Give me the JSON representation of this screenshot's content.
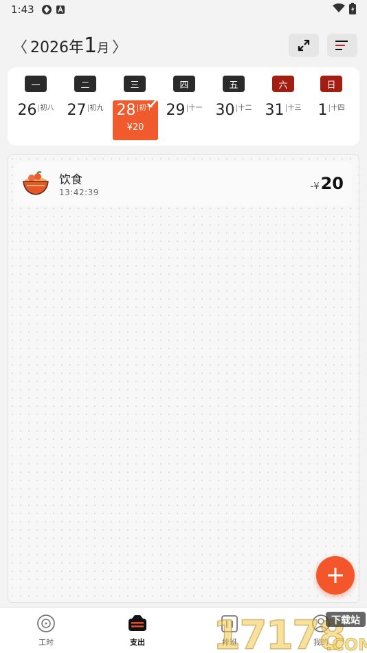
{
  "status_bar": {
    "time": "1:43",
    "icons": [
      "app-notification-icon",
      "a-badge-icon"
    ],
    "right_icons": [
      "wifi-icon",
      "battery-icon"
    ]
  },
  "header": {
    "prev": "〈",
    "year": "2026年",
    "month_num": "1",
    "month_suffix": "月",
    "next": "〉",
    "expand_icon": "expand-icon",
    "menu_icon": "menu-icon"
  },
  "week": {
    "days": [
      {
        "weekday": "一",
        "date": "26",
        "lunar": "初八",
        "weekend": false
      },
      {
        "weekday": "二",
        "date": "27",
        "lunar": "初九",
        "weekend": false
      },
      {
        "weekday": "三",
        "date": "28",
        "lunar": "初十",
        "weekend": false,
        "selected": true,
        "amount": "¥20"
      },
      {
        "weekday": "四",
        "date": "29",
        "lunar": "十一",
        "weekend": false
      },
      {
        "weekday": "五",
        "date": "30",
        "lunar": "十二",
        "weekend": false
      },
      {
        "weekday": "六",
        "date": "31",
        "lunar": "十三",
        "weekend": true
      },
      {
        "weekday": "日",
        "date": "1",
        "lunar": "十四",
        "weekend": true
      }
    ]
  },
  "records": [
    {
      "category": "饮食",
      "time": "13:42:39",
      "sign": "-¥",
      "amount": "20",
      "icon": "food-bowl-icon"
    }
  ],
  "bottom_nav": {
    "items": [
      {
        "label": "工时",
        "icon": "clock-icon",
        "active": false
      },
      {
        "label": "支出",
        "icon": "wallet-icon",
        "active": true
      },
      {
        "label": "排班",
        "icon": "schedule-icon",
        "active": false
      },
      {
        "label": "我的",
        "icon": "profile-icon",
        "active": false
      }
    ]
  },
  "watermark": {
    "text": "17178",
    "tag": "下载站",
    "suffix": ".COM"
  },
  "colors": {
    "accent": "#f05a2c",
    "weekday_dark": "#2a2a2a",
    "weekend_red": "#a21d12"
  }
}
